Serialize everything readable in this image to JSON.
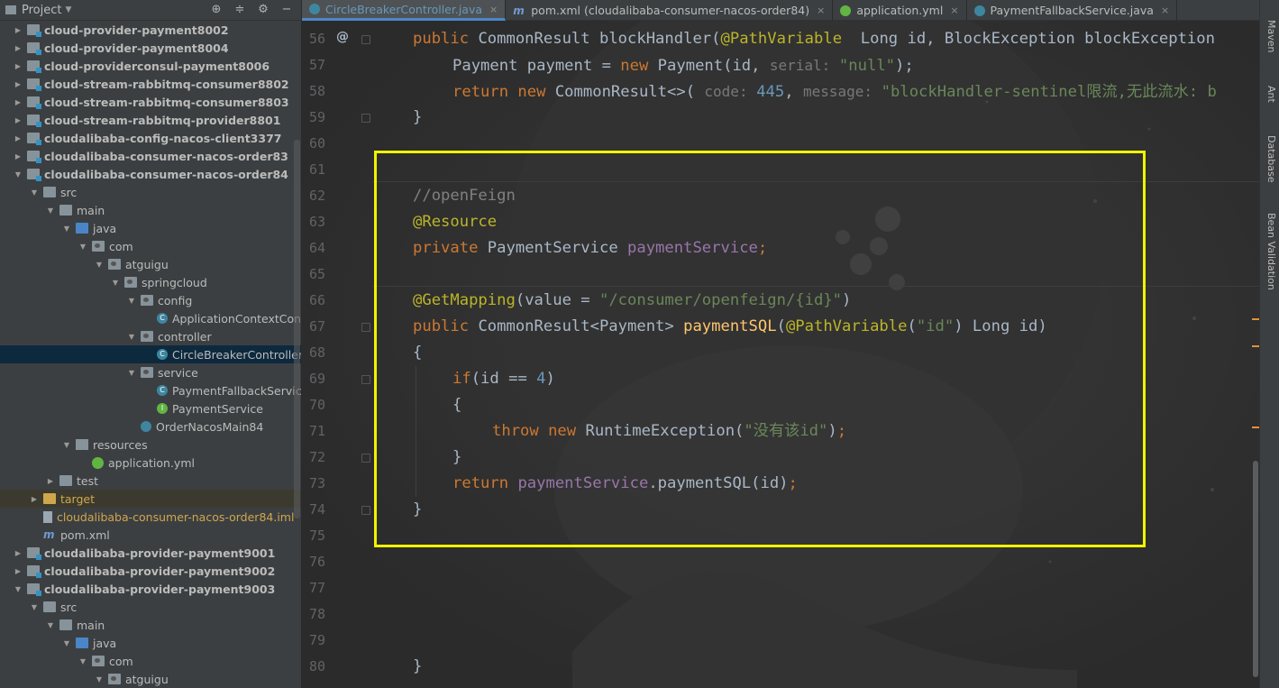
{
  "project_panel": {
    "title": "Project",
    "tree": [
      {
        "label": "cloud-provider-payment8002",
        "level": 1,
        "arrow": "collapsed",
        "icon": "module",
        "bold": true
      },
      {
        "label": "cloud-provider-payment8004",
        "level": 1,
        "arrow": "collapsed",
        "icon": "module",
        "bold": true
      },
      {
        "label": "cloud-providerconsul-payment8006",
        "level": 1,
        "arrow": "collapsed",
        "icon": "module",
        "bold": true
      },
      {
        "label": "cloud-stream-rabbitmq-consumer8802",
        "level": 1,
        "arrow": "collapsed",
        "icon": "module",
        "bold": true
      },
      {
        "label": "cloud-stream-rabbitmq-consumer8803",
        "level": 1,
        "arrow": "collapsed",
        "icon": "module",
        "bold": true
      },
      {
        "label": "cloud-stream-rabbitmq-provider8801",
        "level": 1,
        "arrow": "collapsed",
        "icon": "module",
        "bold": true
      },
      {
        "label": "cloudalibaba-config-nacos-client3377",
        "level": 1,
        "arrow": "collapsed",
        "icon": "module",
        "bold": true
      },
      {
        "label": "cloudalibaba-consumer-nacos-order83",
        "level": 1,
        "arrow": "collapsed",
        "icon": "module",
        "bold": true
      },
      {
        "label": "cloudalibaba-consumer-nacos-order84",
        "level": 1,
        "arrow": "expanded",
        "icon": "module",
        "bold": true
      },
      {
        "label": "src",
        "level": 2,
        "arrow": "expanded",
        "icon": "folder",
        "bold": false
      },
      {
        "label": "main",
        "level": 3,
        "arrow": "expanded",
        "icon": "folder",
        "bold": false
      },
      {
        "label": "java",
        "level": 4,
        "arrow": "expanded",
        "icon": "src-folder",
        "bold": false
      },
      {
        "label": "com",
        "level": 5,
        "arrow": "expanded",
        "icon": "pkg",
        "bold": false
      },
      {
        "label": "atguigu",
        "level": 6,
        "arrow": "expanded",
        "icon": "pkg",
        "bold": false
      },
      {
        "label": "springcloud",
        "level": 7,
        "arrow": "expanded",
        "icon": "pkg",
        "bold": false
      },
      {
        "label": "config",
        "level": 8,
        "arrow": "expanded",
        "icon": "pkg",
        "bold": false
      },
      {
        "label": "ApplicationContextConf",
        "level": 9,
        "arrow": "none",
        "icon": "classc",
        "bold": false
      },
      {
        "label": "controller",
        "level": 8,
        "arrow": "expanded",
        "icon": "pkg",
        "bold": false
      },
      {
        "label": "CircleBreakerController",
        "level": 9,
        "arrow": "none",
        "icon": "classc",
        "bold": false,
        "selected": true
      },
      {
        "label": "service",
        "level": 8,
        "arrow": "expanded",
        "icon": "pkg",
        "bold": false
      },
      {
        "label": "PaymentFallbackService",
        "level": 9,
        "arrow": "none",
        "icon": "classc",
        "bold": false
      },
      {
        "label": "PaymentService",
        "level": 9,
        "arrow": "none",
        "icon": "iface",
        "bold": false
      },
      {
        "label": "OrderNacosMain84",
        "level": 8,
        "arrow": "none",
        "icon": "main-class",
        "bold": false
      },
      {
        "label": "resources",
        "level": 4,
        "arrow": "expanded",
        "icon": "res",
        "bold": false
      },
      {
        "label": "application.yml",
        "level": 5,
        "arrow": "none",
        "icon": "yml",
        "bold": false
      },
      {
        "label": "test",
        "level": 3,
        "arrow": "collapsed",
        "icon": "folder",
        "bold": false
      },
      {
        "label": "target",
        "level": 2,
        "arrow": "collapsed",
        "icon": "excluded",
        "bold": false,
        "excluded": true
      },
      {
        "label": "cloudalibaba-consumer-nacos-order84.iml",
        "level": 2,
        "arrow": "none",
        "icon": "iml",
        "bold": false,
        "excluded": true
      },
      {
        "label": "pom.xml",
        "level": 2,
        "arrow": "none",
        "icon": "mvn",
        "bold": false
      },
      {
        "label": "cloudalibaba-provider-payment9001",
        "level": 1,
        "arrow": "collapsed",
        "icon": "module",
        "bold": true
      },
      {
        "label": "cloudalibaba-provider-payment9002",
        "level": 1,
        "arrow": "collapsed",
        "icon": "module",
        "bold": true
      },
      {
        "label": "cloudalibaba-provider-payment9003",
        "level": 1,
        "arrow": "expanded",
        "icon": "module",
        "bold": true
      },
      {
        "label": "src",
        "level": 2,
        "arrow": "expanded",
        "icon": "folder",
        "bold": false
      },
      {
        "label": "main",
        "level": 3,
        "arrow": "expanded",
        "icon": "folder",
        "bold": false
      },
      {
        "label": "java",
        "level": 4,
        "arrow": "expanded",
        "icon": "src-folder",
        "bold": false
      },
      {
        "label": "com",
        "level": 5,
        "arrow": "expanded",
        "icon": "pkg",
        "bold": false
      },
      {
        "label": "atguigu",
        "level": 6,
        "arrow": "expanded",
        "icon": "pkg",
        "bold": false
      }
    ]
  },
  "editor": {
    "tabs": [
      {
        "label": "CircleBreakerController.java",
        "icon": "class",
        "active": true
      },
      {
        "label": "pom.xml (cloudalibaba-consumer-nacos-order84)",
        "icon": "mvn",
        "active": false
      },
      {
        "label": "application.yml",
        "icon": "yml",
        "active": false
      },
      {
        "label": "PaymentFallbackService.java",
        "icon": "class",
        "active": false
      }
    ],
    "gutter_marker": "@",
    "lines": [
      {
        "n": "56",
        "indent": 1,
        "tokens": [
          [
            "kw",
            "public "
          ],
          [
            "ident",
            "CommonResult "
          ],
          [
            "fn-muted",
            "blockHandler"
          ],
          [
            "ident",
            "("
          ],
          [
            "ann",
            "@PathVariable"
          ],
          [
            "ident",
            "  Long id, BlockException blockException"
          ]
        ]
      },
      {
        "n": "57",
        "indent": 2,
        "tokens": [
          [
            "ident",
            "Payment payment = "
          ],
          [
            "kw",
            "new "
          ],
          [
            "ident",
            "Payment(id, "
          ],
          [
            "hint",
            "serial: "
          ],
          [
            "str",
            "\"null\""
          ],
          [
            "ident",
            ");"
          ]
        ]
      },
      {
        "n": "58",
        "indent": 2,
        "tokens": [
          [
            "kw",
            "return new "
          ],
          [
            "ident",
            "CommonResult<>( "
          ],
          [
            "hint",
            "code: "
          ],
          [
            "num",
            "445"
          ],
          [
            "ident",
            ", "
          ],
          [
            "hint",
            "message: "
          ],
          [
            "str",
            "\"blockHandler-sentinel限流,无此流水: b"
          ]
        ]
      },
      {
        "n": "59",
        "indent": 1,
        "tokens": [
          [
            "ident",
            "}"
          ]
        ]
      },
      {
        "n": "60",
        "indent": 0,
        "tokens": []
      },
      {
        "n": "61",
        "indent": 0,
        "tokens": []
      },
      {
        "n": "62",
        "indent": 1,
        "tokens": [
          [
            "cm",
            "//openFeign"
          ]
        ]
      },
      {
        "n": "63",
        "indent": 1,
        "tokens": [
          [
            "ann",
            "@Resource"
          ]
        ]
      },
      {
        "n": "64",
        "indent": 1,
        "tokens": [
          [
            "kw",
            "private "
          ],
          [
            "ident",
            "PaymentService "
          ],
          [
            "fld",
            "paymentService"
          ],
          [
            "kw",
            ";"
          ]
        ]
      },
      {
        "n": "65",
        "indent": 0,
        "tokens": []
      },
      {
        "n": "66",
        "indent": 1,
        "tokens": [
          [
            "ann",
            "@GetMapping"
          ],
          [
            "ident",
            "("
          ],
          [
            "ident",
            "value = "
          ],
          [
            "str",
            "\"/consumer/openfeign/{id}\""
          ],
          [
            "ident",
            ")"
          ]
        ]
      },
      {
        "n": "67",
        "indent": 1,
        "tokens": [
          [
            "kw",
            "public "
          ],
          [
            "ident",
            "CommonResult<Payment> "
          ],
          [
            "fn",
            "paymentSQL"
          ],
          [
            "ident",
            "("
          ],
          [
            "ann",
            "@PathVariable"
          ],
          [
            "ident",
            "("
          ],
          [
            "str",
            "\"id\""
          ],
          [
            "ident",
            ") Long id)"
          ]
        ]
      },
      {
        "n": "68",
        "indent": 1,
        "tokens": [
          [
            "ident",
            "{"
          ]
        ]
      },
      {
        "n": "69",
        "indent": 2,
        "tokens": [
          [
            "kw",
            "if"
          ],
          [
            "ident",
            "(id == "
          ],
          [
            "num",
            "4"
          ],
          [
            "ident",
            ")"
          ]
        ]
      },
      {
        "n": "70",
        "indent": 2,
        "tokens": [
          [
            "ident",
            "{"
          ]
        ]
      },
      {
        "n": "71",
        "indent": 3,
        "tokens": [
          [
            "kw",
            "throw new "
          ],
          [
            "ident",
            "RuntimeException("
          ],
          [
            "str",
            "\"没有该id\""
          ],
          [
            "ident",
            ")"
          ],
          [
            "kw",
            ";"
          ]
        ]
      },
      {
        "n": "72",
        "indent": 2,
        "tokens": [
          [
            "ident",
            "}"
          ]
        ]
      },
      {
        "n": "73",
        "indent": 2,
        "tokens": [
          [
            "kw",
            "return "
          ],
          [
            "fld",
            "paymentService"
          ],
          [
            "ident",
            ".paymentSQL(id)"
          ],
          [
            "kw",
            ";"
          ]
        ]
      },
      {
        "n": "74",
        "indent": 1,
        "tokens": [
          [
            "ident",
            "}"
          ]
        ]
      },
      {
        "n": "75",
        "indent": 0,
        "tokens": []
      },
      {
        "n": "76",
        "indent": 0,
        "tokens": []
      },
      {
        "n": "77",
        "indent": 0,
        "tokens": []
      },
      {
        "n": "78",
        "indent": 0,
        "tokens": []
      },
      {
        "n": "79",
        "indent": 0,
        "tokens": []
      },
      {
        "n": "80",
        "indent": 0,
        "tokens": [
          [
            "ident",
            "}"
          ]
        ]
      }
    ]
  },
  "right_tools": [
    "Maven",
    "Ant",
    "Database",
    "Bean Validation"
  ],
  "colors": {
    "keyword": "#cc7832",
    "annotation": "#bbb529",
    "string": "#6a8759",
    "number": "#6897bb",
    "comment": "#808080",
    "field": "#9876aa",
    "method": "#ffc66d",
    "highlight_box": "#f2f200"
  }
}
